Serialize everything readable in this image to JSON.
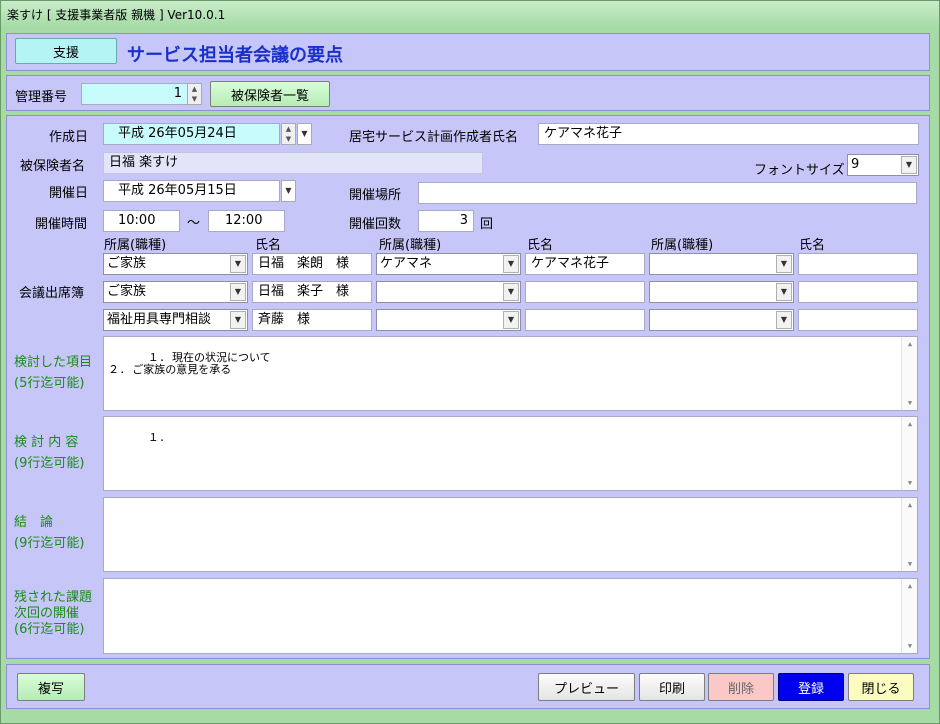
{
  "window": {
    "title": "楽すけ [ 支援事業者版 親機 ] Ver10.0.1"
  },
  "header": {
    "badge": "支援",
    "title": "サービス担当者会議の要点"
  },
  "mgmt": {
    "label": "管理番号",
    "value": "1",
    "list_button": "被保険者一覧"
  },
  "form": {
    "created_label": "作成日",
    "created_value": "平成 26年05月24日",
    "planner_label": "居宅サービス計画作成者氏名",
    "planner_value": "ケアマネ花子",
    "insured_label": "被保険者名",
    "insured_value": "日福 楽すけ",
    "fontsize_label": "フォントサイズ",
    "fontsize_value": "9",
    "held_label": "開催日",
    "held_value": "平成 26年05月15日",
    "place_label": "開催場所",
    "place_value": "",
    "time_label": "開催時間",
    "time_start": "10:00",
    "time_sep": "～",
    "time_end": "12:00",
    "count_label": "開催回数",
    "count_value": "3",
    "count_unit": "回"
  },
  "attendance": {
    "label": "会議出席簿",
    "col_affiliation": "所属(職種)",
    "col_name": "氏名",
    "rows": [
      [
        {
          "aff": "ご家族",
          "name": "日福　楽朗　様"
        },
        {
          "aff": "ケアマネ",
          "name": "ケアマネ花子"
        },
        {
          "aff": "",
          "name": ""
        }
      ],
      [
        {
          "aff": "ご家族",
          "name": "日福　楽子　様"
        },
        {
          "aff": "",
          "name": ""
        },
        {
          "aff": "",
          "name": ""
        }
      ],
      [
        {
          "aff": "福祉用具専門相談",
          "name": "斉藤　様"
        },
        {
          "aff": "",
          "name": ""
        },
        {
          "aff": "",
          "name": ""
        }
      ]
    ]
  },
  "sections": {
    "items_label": "検討した項目",
    "items_limit": "(5行迄可能)",
    "items_text": "１. 現在の状況について\n２. ご家族の意見を承る",
    "content_label": "検 討 内 容",
    "content_limit": "(9行迄可能)",
    "content_text": "１.",
    "conclusion_label": "結　論",
    "conclusion_limit": "(9行迄可能)",
    "conclusion_text": "",
    "issues_label_1": "残された課題",
    "issues_label_2": "次回の開催",
    "issues_limit": "(6行迄可能)",
    "issues_text": ""
  },
  "footer": {
    "copy": "複写",
    "preview": "プレビュー",
    "print": "印刷",
    "delete": "削除",
    "register": "登録",
    "close": "閉じる"
  },
  "colors": {
    "panel": "#c7c6f8",
    "title_blue": "#1a30c8",
    "green_text": "#1a8a1a",
    "register": "#0000ee",
    "delete": "#fbc8c8",
    "close": "#fcfcc0"
  }
}
